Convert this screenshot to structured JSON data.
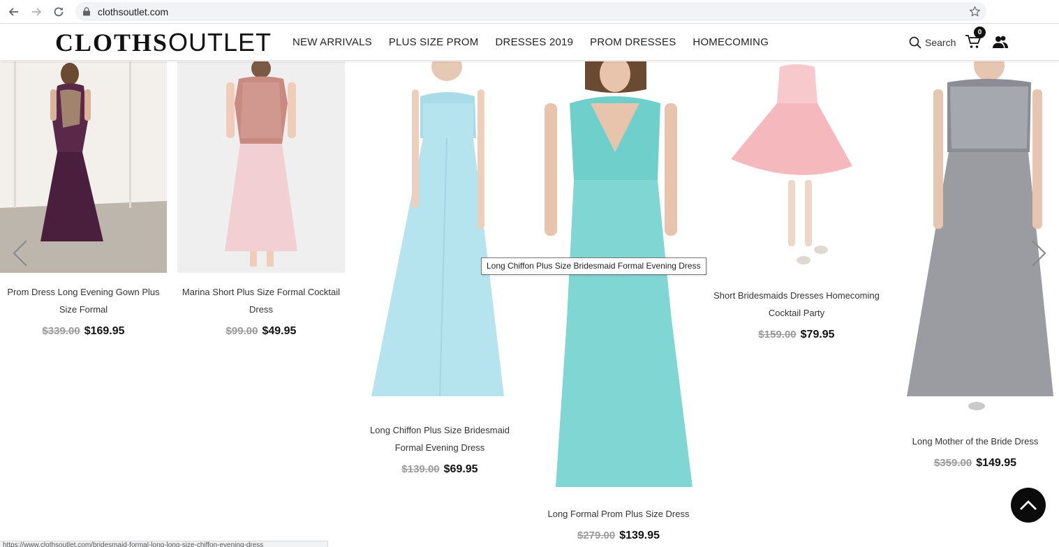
{
  "browser": {
    "url": "clothsoutlet.com"
  },
  "header": {
    "logo_bold": "CLOTHS",
    "logo_light": "OUTLET",
    "nav": [
      {
        "label": "NEW ARRIVALS"
      },
      {
        "label": "PLUS SIZE PROM"
      },
      {
        "label": "DRESSES 2019"
      },
      {
        "label": "PROM DRESSES"
      },
      {
        "label": "HOMECOMING"
      }
    ],
    "search_label": "Search",
    "cart_count": "0"
  },
  "products": [
    {
      "name": "Prom Dress Long Evening Gown Plus Size Formal",
      "old_price": "$339.00",
      "price": "$169.95",
      "color": "#4a1f3d",
      "bg": "#e6e1da"
    },
    {
      "name": "Marina Short Plus Size Formal Cocktail Dress",
      "old_price": "$99.00",
      "price": "$49.95",
      "color": "#f2cfd3",
      "bg": "#eeeeee"
    },
    {
      "name": "Long Chiffon Plus Size Bridesmaid Formal Evening Dress",
      "old_price": "$139.00",
      "price": "$69.95",
      "color": "#b5e3ee",
      "bg": "#ffffff"
    },
    {
      "name": "Long Formal Prom Plus Size Dress",
      "old_price": "$279.00",
      "price": "$139.95",
      "color": "#7fd6d3",
      "bg": "#ffffff"
    },
    {
      "name": "Short Bridesmaids Dresses Homecoming Cocktail Party",
      "old_price": "$159.00",
      "price": "$79.95",
      "color": "#f5b9bd",
      "bg": "#ffffff"
    },
    {
      "name": "Long Mother of the Bride Dress",
      "old_price": "$359.00",
      "price": "$149.95",
      "color": "#9a9ca1",
      "bg": "#ffffff"
    }
  ],
  "tooltip": "Long Chiffon Plus Size Bridesmaid Formal Evening Dress",
  "status_bar": "https://www.clothsoutlet.com/bridesmaid-formal-long-long-size-chiffon-evening-dress"
}
